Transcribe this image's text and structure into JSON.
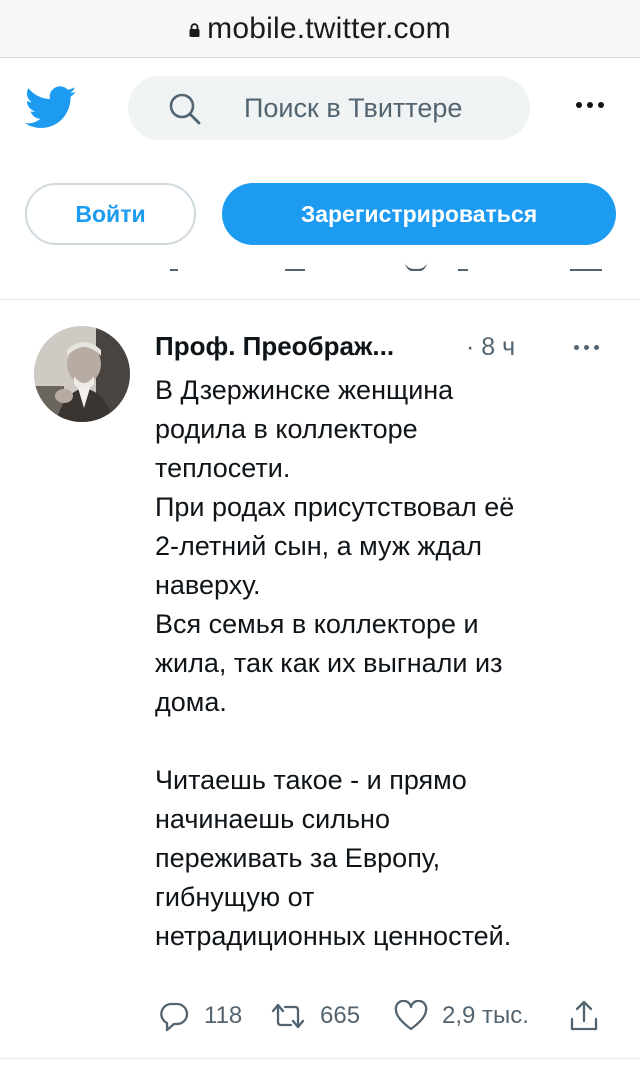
{
  "browser": {
    "url": "mobile.twitter.com"
  },
  "header": {
    "search_placeholder": "Поиск в Твиттере",
    "login_label": "Войти",
    "signup_label": "Зарегистрироваться",
    "brand_color": "#1d9bf0"
  },
  "tweet": {
    "author": "Проф. Преображ...",
    "time": "· 8 ч",
    "paragraph1": [
      "В Дзержинске женщина",
      "родила в коллекторе",
      "теплосети.",
      "При родах присутствовал её",
      "2-летний сын, а муж ждал",
      "наверху.",
      "Вся семья в коллекторе и",
      "жила, так как их выгнали из",
      "дома."
    ],
    "paragraph2": [
      "Читаешь такое - и прямо",
      "начинаешь сильно",
      "переживать за Европу,",
      "гибнущую от",
      "нетрадиционных ценностей."
    ],
    "replies": "118",
    "retweets": "665",
    "likes": "2,9 тыс."
  },
  "icons": [
    "lock-icon",
    "twitter-logo-icon",
    "search-icon",
    "more-icon",
    "reply-icon",
    "retweet-icon",
    "like-icon",
    "share-icon"
  ]
}
